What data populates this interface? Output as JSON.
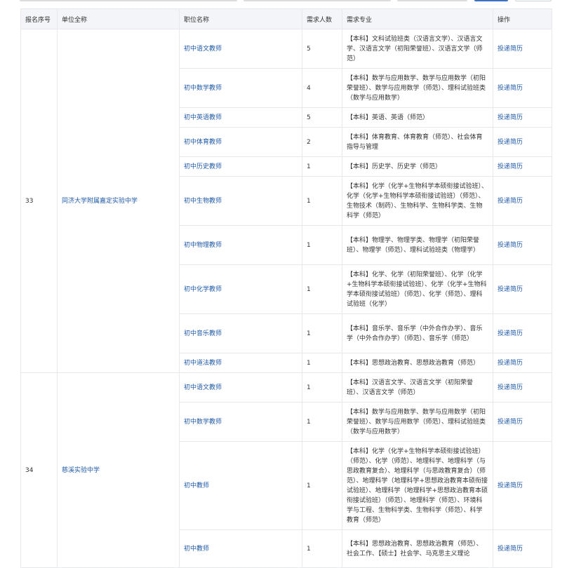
{
  "headers": {
    "seq": "报名序号",
    "unit": "单位全称",
    "position": "职位名称",
    "count": "需求人数",
    "major": "需求专业",
    "action": "操作"
  },
  "groups": [
    {
      "seq": "33",
      "unit": "同济大学附属嘉定实验中学",
      "rows": [
        {
          "position": "初中语文教师",
          "count": "5",
          "major": "【本科】文科试验班类（汉语言文学）、汉语言文学、汉语言文学（初阳荣誉班）、汉语言文学（师范）",
          "action": "投递简历"
        },
        {
          "position": "初中数学教师",
          "count": "4",
          "major": "【本科】数学与应用数学、数学与应用数学（初阳荣誉班）、数学与应用数学（师范）、理科试验班类（数学与应用数学）",
          "action": "投递简历"
        },
        {
          "position": "初中英语教师",
          "count": "5",
          "major": "【本科】英语、英语（师范）",
          "action": "投递简历"
        },
        {
          "position": "初中体育教师",
          "count": "2",
          "major": "【本科】体育教育、体育教育（师范）、社会体育指导与管理",
          "action": "投递简历"
        },
        {
          "position": "初中历史教师",
          "count": "1",
          "major": "【本科】历史学、历史学（师范）",
          "action": "投递简历"
        },
        {
          "position": "初中生物教师",
          "count": "1",
          "major": "【本科】化学（化学+生物科学本硕衔接试验班）、化学（化学+生物科学本硕衔接试验班）（师范）、生物技术（制药）、生物科学、生物科学类、生物科学（师范）",
          "action": "投递简历"
        },
        {
          "position": "初中物理教师",
          "count": "1",
          "major": "【本科】物理学、物理学类、物理学（初阳荣誉班）、物理学（师范）、理科试验班类（物理学）",
          "action": "投递简历"
        },
        {
          "position": "初中化学教师",
          "count": "1",
          "major": "【本科】化学、化学（初阳荣誉班）、化学（化学+生物科学本硕衔接试验班）、化学（化学+生物科学本硕衔接试验班）（师范）、化学（师范）、理科试验班（化学）",
          "action": "投递简历"
        },
        {
          "position": "初中音乐教师",
          "count": "1",
          "major": "【本科】音乐学、音乐学（中外合作办学）、音乐学（中外合作办学）（师范）、音乐学（师范）",
          "action": "投递简历"
        },
        {
          "position": "初中道法教师",
          "count": "1",
          "major": "【本科】思想政治教育、思想政治教育（师范）",
          "action": "投递简历"
        }
      ]
    },
    {
      "seq": "34",
      "unit": "慈溪实验中学",
      "rows": [
        {
          "position": "初中语文教师",
          "count": "1",
          "major": "【本科】汉语言文学、汉语言文学（初阳荣誉班）、汉语言文学（师范）",
          "action": "投递简历"
        },
        {
          "position": "初中数学教师",
          "count": "1",
          "major": "【本科】数学与应用数学、数学与应用数学（初阳荣誉班）、数学与应用数学（师范）、理科试验班类（数学与应用数学）",
          "action": "投递简历"
        },
        {
          "position": "初中教师",
          "count": "1",
          "major": "【本科】化学（化学+生物科学本硕衔接试验班）（师范）、化学（师范）、地理科学、地理科学（与思政教育复合）、地理科学（与思政教育复合）（师范）、地理科学（地理科学+思想政治教育本硕衔接试验班）、地理科学（地理科学+思想政治教育本硕衔接试验班）（师范）、地理科学（师范）、环境科学与工程、生物科学类、生物科学（师范）、科学教育（师范）",
          "action": "投递简历"
        },
        {
          "position": "初中教师",
          "count": "1",
          "major": "【本科】思想政治教育、思想政治教育（师范）、社会工作、【硕士】社会学、马克思主义理论",
          "action": "投递简历"
        }
      ]
    }
  ]
}
